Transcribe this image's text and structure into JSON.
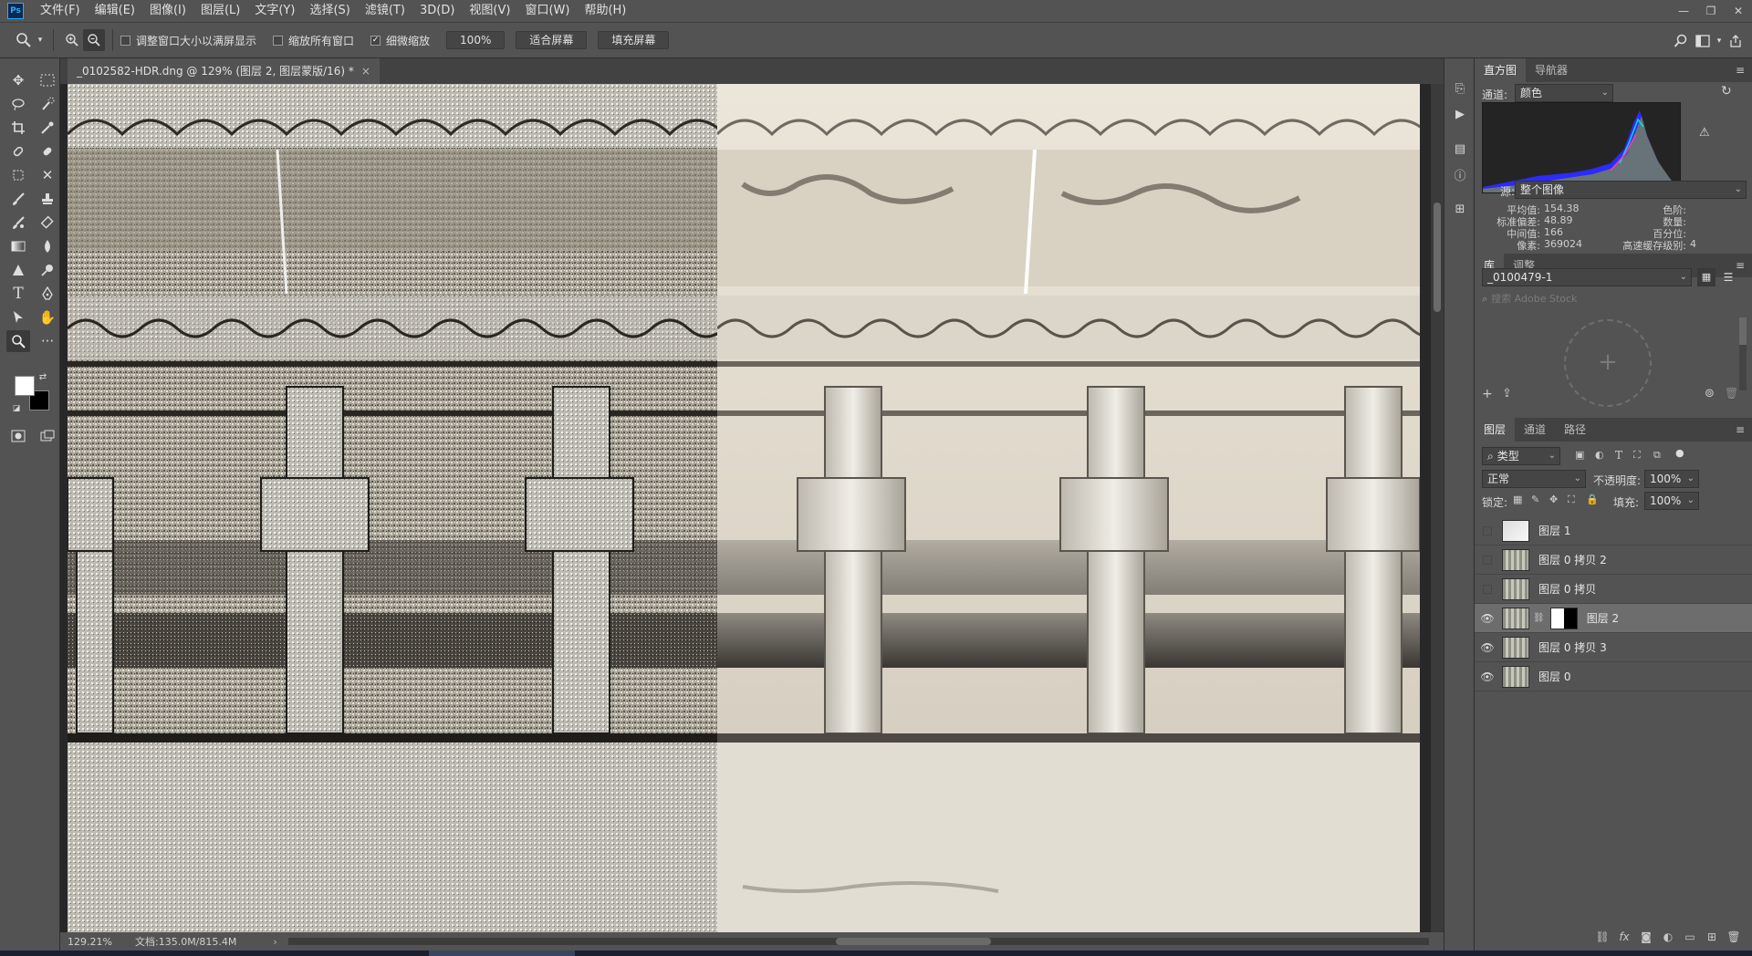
{
  "app": {
    "logo": "Ps"
  },
  "menu": [
    "文件(F)",
    "编辑(E)",
    "图像(I)",
    "图层(L)",
    "文字(Y)",
    "选择(S)",
    "滤镜(T)",
    "3D(D)",
    "视图(V)",
    "窗口(W)",
    "帮助(H)"
  ],
  "window": {
    "minimize": "—",
    "restore": "❐",
    "close": "✕"
  },
  "options": {
    "resize_windows": "调整窗口大小以满屏显示",
    "zoom_all_windows": "缩放所有窗口",
    "scrubby_zoom": "细微缩放",
    "zoom_value": "100%",
    "fit_screen": "适合屏幕",
    "fill_screen": "填充屏幕"
  },
  "document": {
    "tab_title": "_0102582-HDR.dng @ 129% (图层 2, 图层蒙版/16) *",
    "close": "×"
  },
  "status": {
    "zoom": "129.21%",
    "doc": "文档:135.0M/815.4M"
  },
  "histogram": {
    "tabs": [
      "直方图",
      "导航器"
    ],
    "channel_label": "通道:",
    "channel_value": "颜色",
    "source_label": "源:",
    "source_value": "整个图像",
    "stats": {
      "mean_label": "平均值:",
      "mean": "154.38",
      "std_label": "标准偏差:",
      "std": "48.89",
      "median_label": "中间值:",
      "median": "166",
      "pixels_label": "像素:",
      "pixels": "369024",
      "level_label": "色阶:",
      "count_label": "数量:",
      "percentile_label": "百分位:",
      "cache_label": "高速缓存级别:",
      "cache": "4"
    }
  },
  "library": {
    "tabs": [
      "库",
      "调整"
    ],
    "dropdown": "_0100479-1",
    "search_placeholder": "搜索 Adobe Stock"
  },
  "layers": {
    "tabs": [
      "图层",
      "通道",
      "路径"
    ],
    "filter": "类型",
    "blend_mode": "正常",
    "opacity_label": "不透明度:",
    "opacity": "100%",
    "lock_label": "锁定:",
    "fill_label": "填充:",
    "fill": "100%",
    "items": [
      {
        "name": "图层 1",
        "visible": false,
        "selected": false,
        "has_mask": false
      },
      {
        "name": "图层 0 拷贝 2",
        "visible": false,
        "selected": false,
        "has_mask": false
      },
      {
        "name": "图层 0 拷贝",
        "visible": false,
        "selected": false,
        "has_mask": false
      },
      {
        "name": "图层 2",
        "visible": true,
        "selected": true,
        "has_mask": true
      },
      {
        "name": "图层 0 拷贝 3",
        "visible": true,
        "selected": false,
        "has_mask": false
      },
      {
        "name": "图层 0",
        "visible": true,
        "selected": false,
        "has_mask": false
      }
    ]
  },
  "colors": {
    "ui_bg": "#535353",
    "panel_dark": "#424242",
    "canvas_bg": "#282828",
    "selected_layer": "#6d6d6d",
    "histogram_blue": "#2b2bff"
  },
  "icons": [
    "zoom-icon",
    "move-icon",
    "marquee-icon",
    "lasso-icon",
    "crop-icon",
    "eyedropper-icon",
    "brush-icon",
    "eraser-icon",
    "gradient-icon",
    "pen-icon",
    "type-icon",
    "hand-icon",
    "eye-icon",
    "lock-icon",
    "warning-icon",
    "refresh-icon",
    "trash-icon"
  ]
}
